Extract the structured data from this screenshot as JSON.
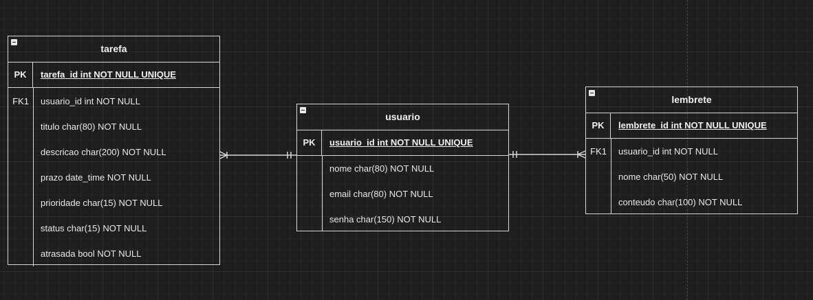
{
  "entities": {
    "tarefa": {
      "title": "tarefa",
      "pk_label": "PK",
      "pk_field": "tarefa_id int NOT NULL UNIQUE",
      "fields": [
        {
          "key": "FK1",
          "text": "usuario_id int NOT NULL"
        },
        {
          "key": "",
          "text": "titulo char(80) NOT NULL"
        },
        {
          "key": "",
          "text": "descricao char(200) NOT NULL"
        },
        {
          "key": "",
          "text": "prazo date_time NOT NULL"
        },
        {
          "key": "",
          "text": "prioridade char(15) NOT NULL"
        },
        {
          "key": "",
          "text": "status char(15) NOT NULL"
        },
        {
          "key": "",
          "text": "atrasada bool NOT NULL"
        }
      ]
    },
    "usuario": {
      "title": "usuario",
      "pk_label": "PK",
      "pk_field": "usuario_id int NOT NULL UNIQUE",
      "fields": [
        {
          "key": "",
          "text": "nome char(80) NOT NULL"
        },
        {
          "key": "",
          "text": "email char(80) NOT NULL"
        },
        {
          "key": "",
          "text": "senha char(150) NOT NULL"
        }
      ]
    },
    "lembrete": {
      "title": "lembrete",
      "pk_label": "PK",
      "pk_field": "lembrete_id int NOT NULL UNIQUE",
      "fields": [
        {
          "key": "FK1",
          "text": "usuario_id int NOT NULL"
        },
        {
          "key": "",
          "text": "nome char(50) NOT NULL"
        },
        {
          "key": "",
          "text": "conteudo char(100) NOT NULL"
        }
      ]
    }
  },
  "relationships": [
    {
      "from": "tarefa",
      "from_cardinality": "one-or-many",
      "to": "usuario",
      "to_cardinality": "exactly-one"
    },
    {
      "from": "usuario",
      "from_cardinality": "exactly-one",
      "to": "lembrete",
      "to_cardinality": "zero-or-many"
    }
  ],
  "colors": {
    "background": "#1e1e1e",
    "stroke": "#d8d8d8",
    "text": "#f0f0f0"
  }
}
